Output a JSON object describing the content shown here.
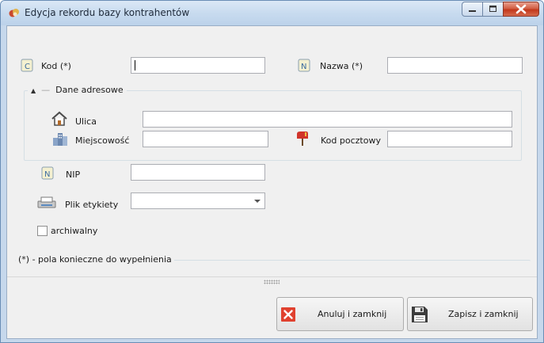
{
  "window": {
    "title": "Edycja rekordu bazy kontrahentów"
  },
  "form": {
    "kod_label": "Kod (*)",
    "kod_value": "",
    "nazwa_label": "Nazwa (*)",
    "nazwa_value": "",
    "address_group_title": "Dane adresowe",
    "ulica_label": "Ulica",
    "ulica_value": "",
    "miejscowosc_label": "Miejscowość",
    "miejscowosc_value": "",
    "kod_pocztowy_label": "Kod pocztowy",
    "kod_pocztowy_value": "",
    "nip_label": "NIP",
    "nip_value": "",
    "plik_etykiety_label": "Plik etykiety",
    "plik_etykiety_value": "",
    "archiwalny_label": "archiwalny",
    "archiwalny_checked": false,
    "footnote": "(*) - pola konieczne do wypełnienia"
  },
  "buttons": {
    "cancel_label": "Anuluj i zamknij",
    "save_label": "Zapisz i zamknij"
  },
  "colors": {
    "close_button": "#c2381c",
    "cancel_icon": "#e0412f"
  }
}
